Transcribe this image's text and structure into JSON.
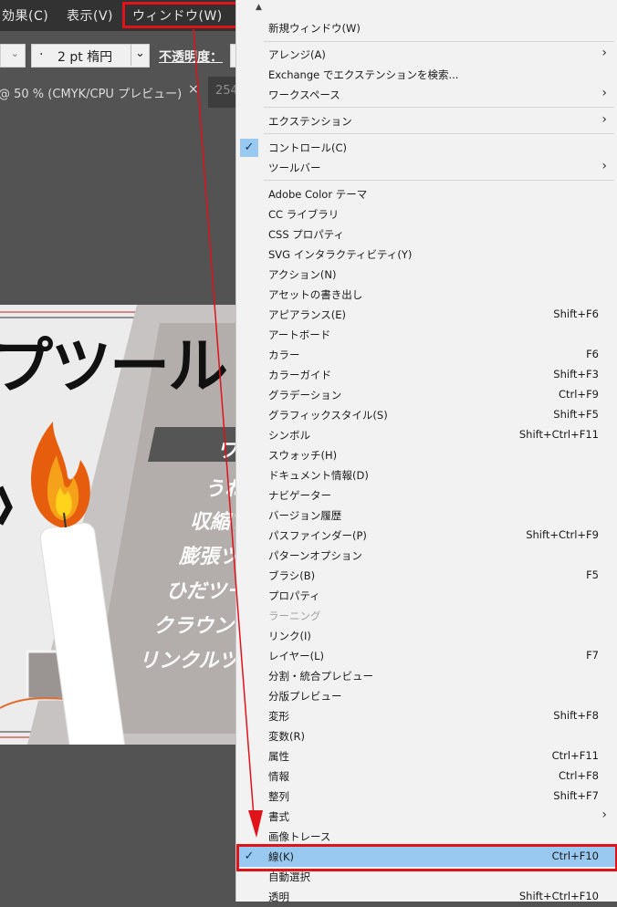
{
  "menubar": {
    "effect": "効果(C)",
    "view": "表示(V)",
    "window": "ウィンドウ(W)"
  },
  "controlbar": {
    "stroke_dot": "·",
    "stroke_profile": "2 pt 楕円",
    "opacity_label": "不透明度："
  },
  "tabs": {
    "active": "@ 50 % (CMYK/CPU プレビュー)",
    "close": "×",
    "inactive": "254"
  },
  "artwork": {
    "title": "プツール",
    "ghost_labels": [
      "ワ",
      "うね",
      "収縮ツ",
      "膨張ツー",
      "ひだツー",
      "クラウンツ",
      "リンクルツー"
    ]
  },
  "colors": {
    "highlight": "#99c9f0",
    "annotation_red": "#e0131a"
  },
  "menu": {
    "scroll_up": "▲",
    "items": [
      {
        "label": "新規ウィンドウ(W)",
        "shortcut": "",
        "submenu": false,
        "checked": false
      },
      {
        "label": "アレンジ(A)",
        "shortcut": "",
        "submenu": true,
        "checked": false
      },
      {
        "label": "Exchange でエクステンションを検索...",
        "shortcut": "",
        "submenu": false,
        "checked": false
      },
      {
        "label": "ワークスペース",
        "shortcut": "",
        "submenu": true,
        "checked": false
      },
      {
        "label": "エクステンション",
        "shortcut": "",
        "submenu": true,
        "checked": false
      },
      {
        "label": "コントロール(C)",
        "shortcut": "",
        "submenu": false,
        "checked": true
      },
      {
        "label": "ツールバー",
        "shortcut": "",
        "submenu": true,
        "checked": false
      },
      {
        "label": "Adobe Color テーマ",
        "shortcut": "",
        "submenu": false,
        "checked": false
      },
      {
        "label": "CC ライブラリ",
        "shortcut": "",
        "submenu": false,
        "checked": false
      },
      {
        "label": "CSS プロパティ",
        "shortcut": "",
        "submenu": false,
        "checked": false
      },
      {
        "label": "SVG インタラクティビティ(Y)",
        "shortcut": "",
        "submenu": false,
        "checked": false
      },
      {
        "label": "アクション(N)",
        "shortcut": "",
        "submenu": false,
        "checked": false
      },
      {
        "label": "アセットの書き出し",
        "shortcut": "",
        "submenu": false,
        "checked": false
      },
      {
        "label": "アピアランス(E)",
        "shortcut": "Shift+F6",
        "submenu": false,
        "checked": false
      },
      {
        "label": "アートボード",
        "shortcut": "",
        "submenu": false,
        "checked": false
      },
      {
        "label": "カラー",
        "shortcut": "F6",
        "submenu": false,
        "checked": false
      },
      {
        "label": "カラーガイド",
        "shortcut": "Shift+F3",
        "submenu": false,
        "checked": false
      },
      {
        "label": "グラデーション",
        "shortcut": "Ctrl+F9",
        "submenu": false,
        "checked": false
      },
      {
        "label": "グラフィックスタイル(S)",
        "shortcut": "Shift+F5",
        "submenu": false,
        "checked": false
      },
      {
        "label": "シンボル",
        "shortcut": "Shift+Ctrl+F11",
        "submenu": false,
        "checked": false
      },
      {
        "label": "スウォッチ(H)",
        "shortcut": "",
        "submenu": false,
        "checked": false
      },
      {
        "label": "ドキュメント情報(D)",
        "shortcut": "",
        "submenu": false,
        "checked": false
      },
      {
        "label": "ナビゲーター",
        "shortcut": "",
        "submenu": false,
        "checked": false
      },
      {
        "label": "バージョン履歴",
        "shortcut": "",
        "submenu": false,
        "checked": false
      },
      {
        "label": "パスファインダー(P)",
        "shortcut": "Shift+Ctrl+F9",
        "submenu": false,
        "checked": false
      },
      {
        "label": "パターンオプション",
        "shortcut": "",
        "submenu": false,
        "checked": false
      },
      {
        "label": "ブラシ(B)",
        "shortcut": "F5",
        "submenu": false,
        "checked": false
      },
      {
        "label": "プロパティ",
        "shortcut": "",
        "submenu": false,
        "checked": false
      },
      {
        "label": "ラーニング",
        "shortcut": "",
        "submenu": false,
        "checked": false,
        "disabled": true
      },
      {
        "label": "リンク(I)",
        "shortcut": "",
        "submenu": false,
        "checked": false
      },
      {
        "label": "レイヤー(L)",
        "shortcut": "F7",
        "submenu": false,
        "checked": false
      },
      {
        "label": "分割・統合プレビュー",
        "shortcut": "",
        "submenu": false,
        "checked": false
      },
      {
        "label": "分版プレビュー",
        "shortcut": "",
        "submenu": false,
        "checked": false
      },
      {
        "label": "変形",
        "shortcut": "Shift+F8",
        "submenu": false,
        "checked": false
      },
      {
        "label": "変数(R)",
        "shortcut": "",
        "submenu": false,
        "checked": false
      },
      {
        "label": "属性",
        "shortcut": "Ctrl+F11",
        "submenu": false,
        "checked": false
      },
      {
        "label": "情報",
        "shortcut": "Ctrl+F8",
        "submenu": false,
        "checked": false
      },
      {
        "label": "整列",
        "shortcut": "Shift+F7",
        "submenu": false,
        "checked": false
      },
      {
        "label": "書式",
        "shortcut": "",
        "submenu": true,
        "checked": false
      },
      {
        "label": "画像トレース",
        "shortcut": "",
        "submenu": false,
        "checked": false
      },
      {
        "label": "線(K)",
        "shortcut": "Ctrl+F10",
        "submenu": false,
        "checked": true,
        "highlighted": true
      },
      {
        "label": "自動選択",
        "shortcut": "",
        "submenu": false,
        "checked": false
      },
      {
        "label": "透明",
        "shortcut": "Shift+Ctrl+F10",
        "submenu": false,
        "checked": false
      }
    ]
  }
}
